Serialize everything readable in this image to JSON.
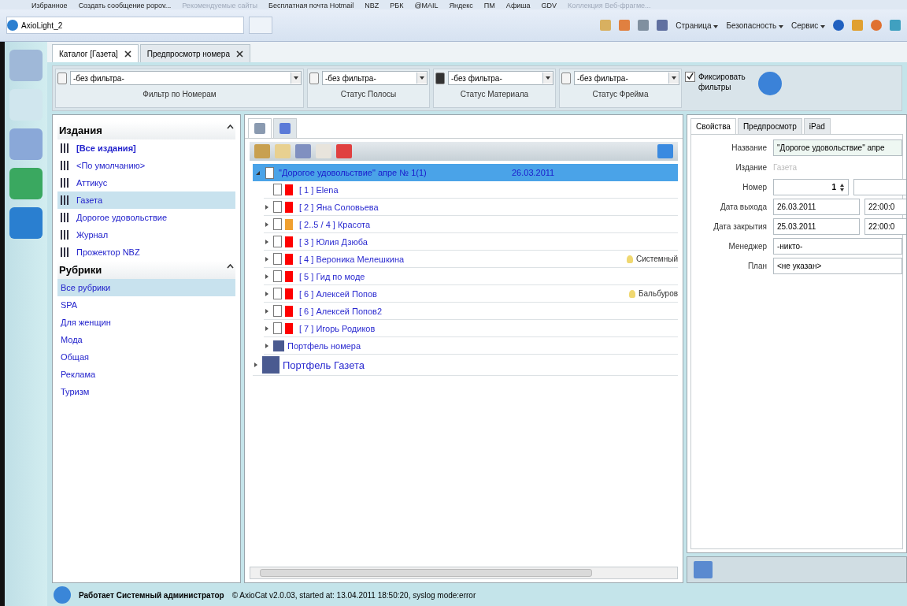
{
  "favorites_bar": {
    "title": "Избранное",
    "links": [
      "Создать сообщение popov...",
      "Рекомендуемые сайты",
      "Бесплатная почта Hotmail",
      "NBZ",
      "РБК",
      "@MAIL",
      "Яндекс",
      "ПМ",
      "Афиша",
      "GDV",
      "Коллекция Веб-фрагме..."
    ]
  },
  "browser_tab": {
    "title": "AxioLight_2"
  },
  "browser_commands": [
    "Страница",
    "Безопасность",
    "Сервис"
  ],
  "app_tabs": [
    {
      "label": "Каталог [Газета]",
      "selected": true
    },
    {
      "label": "Предпросмотр номера",
      "selected": false
    }
  ],
  "filters": [
    {
      "value": "-без фильтра-",
      "caption": "Фильтр по Номерам",
      "kind": "wide"
    },
    {
      "value": "-без фильтра-",
      "caption": "Статус Полосы",
      "kind": "narrow"
    },
    {
      "value": "-без фильтра-",
      "caption": "Статус Материала",
      "kind": "narrow"
    },
    {
      "value": "-без фильтра-",
      "caption": "Статус Фрейма",
      "kind": "narrow"
    }
  ],
  "fix_filters": {
    "label": "Фиксировать фильтры",
    "checked": true
  },
  "sidebar": {
    "sections": [
      {
        "title": "Издания",
        "expanded": true,
        "kind": "editions",
        "items": [
          {
            "label": "[Все издания]",
            "selected": false,
            "bold": true
          },
          {
            "label": "<По умолчанию>",
            "selected": false,
            "bold": false
          },
          {
            "label": "Аттикус",
            "selected": false,
            "bold": false
          },
          {
            "label": "Газета",
            "selected": true,
            "bold": false
          },
          {
            "label": "Дорогое удовольствие",
            "selected": false,
            "bold": false
          },
          {
            "label": "Журнал",
            "selected": false,
            "bold": false
          },
          {
            "label": "Прожектор NBZ",
            "selected": false,
            "bold": false
          }
        ]
      },
      {
        "title": "Рубрики",
        "expanded": true,
        "kind": "rubrics",
        "items": [
          {
            "label": "Все рубрики",
            "selected": true,
            "bold": false
          },
          {
            "label": "SPA",
            "selected": false,
            "bold": false
          },
          {
            "label": "Для женщин",
            "selected": false,
            "bold": false
          },
          {
            "label": "Мода",
            "selected": false,
            "bold": false
          },
          {
            "label": "Общая",
            "selected": false,
            "bold": false
          },
          {
            "label": "Реклама",
            "selected": false,
            "bold": false
          },
          {
            "label": "Туризм",
            "selected": false,
            "bold": false
          }
        ]
      }
    ]
  },
  "view_tabs": [
    {
      "selected": true
    },
    {
      "selected": false
    }
  ],
  "tree": [
    {
      "kind": "issue",
      "label": "\"Дорогое удовольствие\" апре № 1(1)",
      "date": "26.03.2011",
      "selected": true,
      "expanded": true,
      "children": [
        {
          "kind": "page",
          "label": "[ 1 ] Elena",
          "color": "#ff0000",
          "has_children": false
        },
        {
          "kind": "page",
          "label": "[ 2 ] Яна Соловьева",
          "color": "#ff0000",
          "has_children": true
        },
        {
          "kind": "page",
          "label": "[ 2..5 / 4 ] Красота",
          "color": "#f0a030",
          "has_children": true
        },
        {
          "kind": "page",
          "label": "[ 3 ] Юлия Дзюба",
          "color": "#ff0000",
          "has_children": true
        },
        {
          "kind": "page",
          "label": "[ 4 ] Вероника Мелешкина",
          "color": "#ff0000",
          "has_children": true,
          "note": "Системный"
        },
        {
          "kind": "page",
          "label": "[ 5 ] Гид по моде",
          "color": "#ff0000",
          "has_children": true
        },
        {
          "kind": "page",
          "label": "[ 6 ] Алексей Попов",
          "color": "#ff0000",
          "has_children": true,
          "note": "Бальбуров"
        },
        {
          "kind": "page",
          "label": "[ 6 ] Алексей Попов2",
          "color": "#ff0000",
          "has_children": true
        },
        {
          "kind": "page",
          "label": "[ 7 ] Игорь Родиков",
          "color": "#ff0000",
          "has_children": true
        },
        {
          "kind": "portfolio",
          "label": "Портфель номера",
          "has_children": true
        }
      ]
    },
    {
      "kind": "portfolio_big",
      "label": "Портфель Газета",
      "selected": false,
      "expanded": false
    }
  ],
  "props_tabs": [
    {
      "label": "Свойства",
      "selected": true
    },
    {
      "label": "Предпросмотр",
      "selected": false
    },
    {
      "label": "iPad",
      "selected": false
    }
  ],
  "properties": [
    {
      "label": "Название",
      "kind": "text",
      "value": "\"Дорогое удовольствие\" апре"
    },
    {
      "label": "Издание",
      "kind": "static",
      "value": "Газета"
    },
    {
      "label": "Номер",
      "kind": "spin",
      "value": "1"
    },
    {
      "label": "Дата выхода",
      "kind": "datetime",
      "value": "26.03.2011",
      "time": "22:00:0"
    },
    {
      "label": "Дата закрытия",
      "kind": "datetime",
      "value": "25.03.2011",
      "time": "22:00:0"
    },
    {
      "label": "Менеджер",
      "kind": "text",
      "value": "-никто-"
    },
    {
      "label": "План",
      "kind": "text",
      "value": "<не указан>"
    }
  ],
  "status_bar": {
    "user": "Работает Системный администратор",
    "info": "© AxioCat v2.0.03, started at: 13.04.2011 18:50:20, syslog mode:error"
  }
}
